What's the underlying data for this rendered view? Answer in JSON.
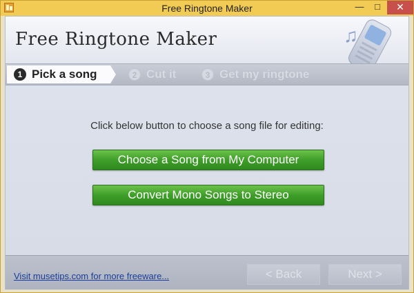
{
  "window": {
    "title": "Free Ringtone Maker",
    "minimize": "—",
    "maximize": "□",
    "close": "✕"
  },
  "header": {
    "app_name": "Free Ringtone Maker",
    "note_glyph": "♫"
  },
  "steps": [
    {
      "number": "1",
      "label": "Pick a song",
      "active": true
    },
    {
      "number": "2",
      "label": "Cut it",
      "active": false
    },
    {
      "number": "3",
      "label": "Get my ringtone",
      "active": false
    }
  ],
  "main": {
    "instruction": "Click below button to choose a song file for editing:",
    "choose_button": "Choose a Song from My Computer",
    "convert_button": "Convert Mono Songs to Stereo"
  },
  "footer": {
    "link": "Visit musetips.com for more freeware...",
    "back_button": "< Back",
    "next_button": "Next >"
  },
  "colors": {
    "titlebar": "#f2cb54",
    "close_button": "#c7504a",
    "accent_green": "#3f9e2a",
    "link": "#1a3c9a"
  },
  "icons": [
    "app-icon",
    "music-note-icon",
    "phone-icon"
  ]
}
